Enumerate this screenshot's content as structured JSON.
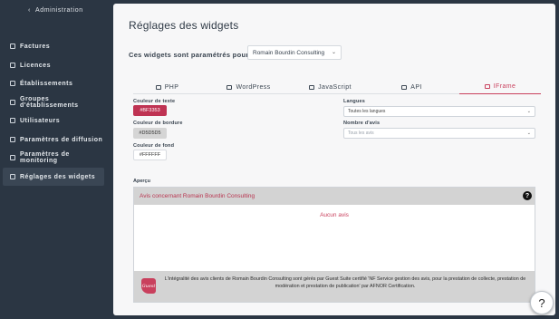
{
  "sidebar": {
    "back_label": "Administration",
    "items": [
      {
        "label": "Factures",
        "icon": "invoice-icon"
      },
      {
        "label": "Licences",
        "icon": "license-icon"
      },
      {
        "label": "Établissements",
        "icon": "building-icon"
      },
      {
        "label": "Groupes d'établissements",
        "icon": "group-icon"
      },
      {
        "label": "Utilisateurs",
        "icon": "users-icon"
      },
      {
        "label": "Paramètres de diffusion",
        "icon": "send-icon"
      },
      {
        "label": "Paramètres de monitoring",
        "icon": "eye-icon"
      },
      {
        "label": "Réglages des widgets",
        "icon": "widget-icon"
      }
    ],
    "active_index": 7
  },
  "main": {
    "title": "Réglages des widgets",
    "config_label": "Ces widgets sont paramétrés pour :",
    "config_value": "Romain Bourdin Consulting",
    "tabs": [
      {
        "label": "PHP"
      },
      {
        "label": "WordPress"
      },
      {
        "label": "JavaScript"
      },
      {
        "label": "API"
      },
      {
        "label": "IFrame"
      }
    ],
    "active_tab": "IFrame"
  },
  "iframe_settings": {
    "text_color_label": "Couleur de texte",
    "text_color": "#BF3353",
    "border_color_label": "Couleur de bordure",
    "border_color": "#D5D5D5",
    "bg_color_label": "Couleur de fond",
    "bg_color": "#FFFFFF",
    "languages_label": "Langues",
    "languages_value": "Toutes les langues",
    "reviews_label": "Nombre d'avis",
    "reviews_placeholder": "Tous les avis"
  },
  "preview": {
    "label": "Aperçu",
    "title": "Avis concernant Romain Bourdin Consulting",
    "help_glyph": "?",
    "empty_text": "Aucun avis",
    "logo_text": "Guest",
    "footer_text": "L'intégralité des avis clients de Romain Bourdin Consulting sont gérés par Guest Suite certifié 'NF Service gestion des avis, pour la prestation de collecte, prestation de modération et prestation de publication' par AFNOR Certification."
  },
  "help_button": "?",
  "colors": {
    "accent": "#c9405d",
    "sidebar_bg": "#2b3643",
    "text_swatch_bg": "#bf3353",
    "border_swatch_bg": "#d5d5d5"
  }
}
